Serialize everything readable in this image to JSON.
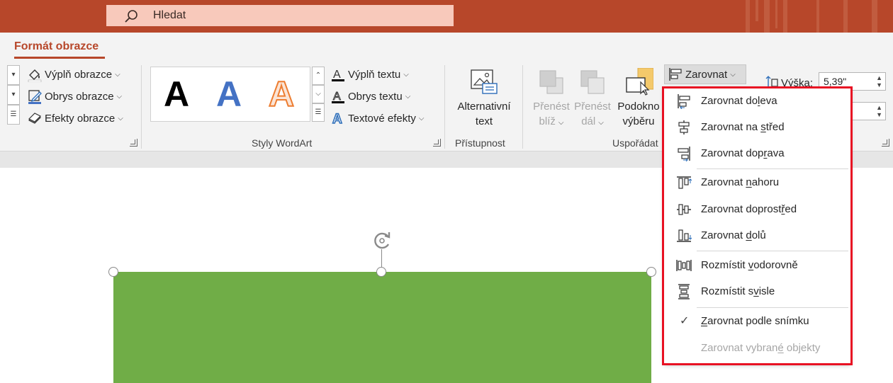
{
  "search": {
    "label": "Hledat"
  },
  "tabs": {
    "active": "Formát obrazce"
  },
  "ribbon": {
    "shape_styles": {
      "fill": "Výplň obrazce",
      "outline": "Obrys obrazce",
      "effects": "Efekty obrazce"
    },
    "wordart": {
      "glyph": "A",
      "text_fill": "Výplň textu",
      "text_outline": "Obrys textu",
      "text_effects": "Textové efekty",
      "group_label": "Styly WordArt"
    },
    "accessibility": {
      "alt_text_line1": "Alternativní",
      "alt_text_line2": "text",
      "group_label": "Přístupnost"
    },
    "arrange": {
      "bring_forward_line1": "Přenést",
      "bring_forward_line2": "blíž",
      "send_backward_line1": "Přenést",
      "send_backward_line2": "dál",
      "selection_pane_line1": "Podokno",
      "selection_pane_line2": "výběru",
      "align_button": "Zarovnat",
      "group_label": "Uspořádat"
    },
    "size": {
      "height_label": "Výška:",
      "height_value": "5,39\""
    }
  },
  "align_menu": {
    "items": [
      {
        "pre": "Zarovnat do",
        "key": "l",
        "post": "eva"
      },
      {
        "pre": "Zarovnat na ",
        "key": "s",
        "post": "třed"
      },
      {
        "pre": "Zarovnat dop",
        "key": "r",
        "post": "ava"
      },
      {
        "pre": "Zarovnat ",
        "key": "n",
        "post": "ahoru"
      },
      {
        "pre": "Zarovnat doprost",
        "key": "ř",
        "post": "ed"
      },
      {
        "pre": "Zarovnat ",
        "key": "d",
        "post": "olů"
      },
      {
        "pre": "Rozmístit ",
        "key": "v",
        "post": "odorovně"
      },
      {
        "pre": "Rozmístit s",
        "key": "v",
        "post": "isle"
      },
      {
        "pre": "",
        "key": "Z",
        "post": "arovnat podle snímku"
      },
      {
        "pre": "Zarovnat vybran",
        "key": "é",
        "post": " objekty"
      }
    ],
    "check_glyph": "✓"
  },
  "colors": {
    "brand": "#b7472a",
    "search_bg": "#f8c9bb",
    "shape_fill": "#70ad47",
    "highlight": "#e81123",
    "wordart_blue": "#4472c4",
    "wordart_orange": "#ed7d31"
  }
}
